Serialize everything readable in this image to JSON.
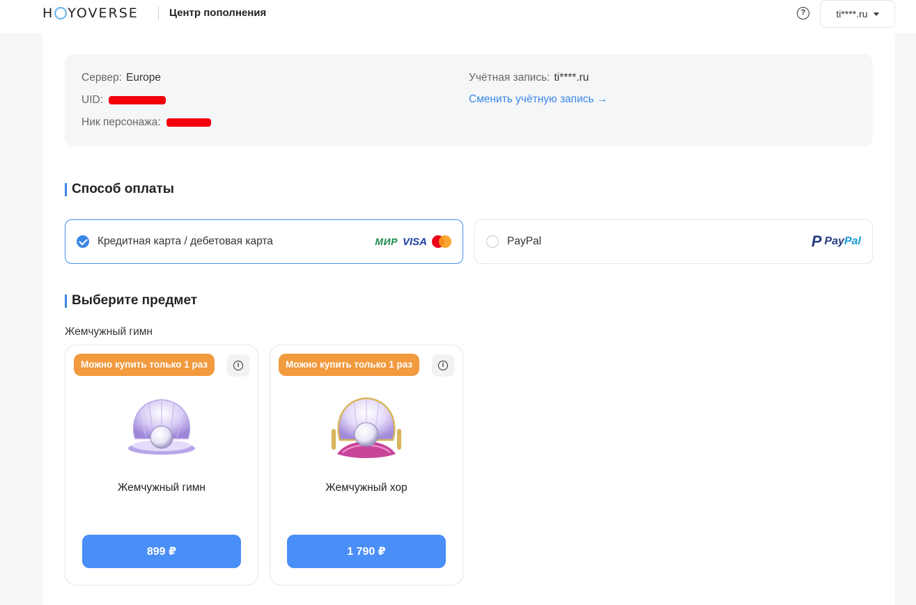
{
  "header": {
    "logo_text": "HOYOVERSE",
    "title": "Центр пополнения",
    "account_label": "ti****.ru"
  },
  "account_info": {
    "server_label": "Сервер:",
    "server_value": "Europe",
    "uid_label": "UID:",
    "nick_label": "Ник персонажа:",
    "account_label": "Учётная запись:",
    "account_value": "ti****.ru",
    "switch_link": "Сменить учётную запись →"
  },
  "payment": {
    "section_title": "Способ оплаты",
    "methods": [
      {
        "label": "Кредитная карта / дебетовая карта",
        "selected": true,
        "brands": [
          "МИР",
          "VISA",
          "mastercard"
        ]
      },
      {
        "label": "PayPal",
        "selected": false,
        "brands": [
          "PayPal"
        ]
      }
    ]
  },
  "items_section": {
    "section_title": "Выберите предмет",
    "group_label": "Жемчужный гимн",
    "items": [
      {
        "badge": "Можно купить только 1 раз",
        "name": "Жемчужный гимн",
        "price": "899 ₽",
        "icon": "pearl-shell-icon"
      },
      {
        "badge": "Можно купить только 1 раз",
        "name": "Жемчужный хор",
        "price": "1 790 ₽",
        "icon": "pearl-shell-gold-icon"
      }
    ]
  },
  "colors": {
    "accent": "#3a86e6",
    "buy_button": "#4a8ef8",
    "badge": "#f19a3e",
    "redaction": "#f4000c"
  }
}
